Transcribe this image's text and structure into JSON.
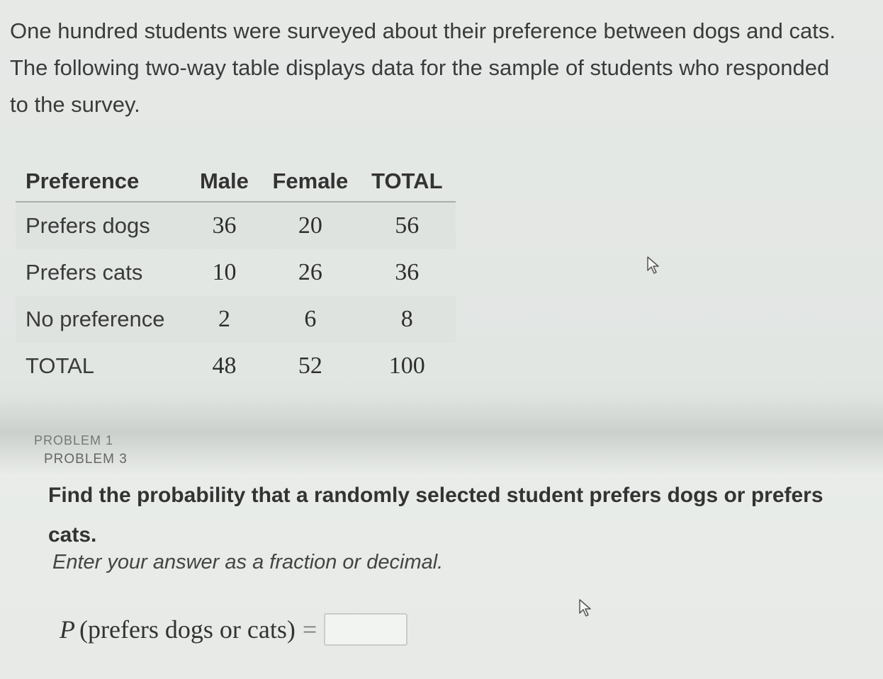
{
  "intro_text": "One hundred students were surveyed about their preference between dogs and cats. The following two-way table displays data for the sample of students who responded to the survey.",
  "table": {
    "headers": [
      "Preference",
      "Male",
      "Female",
      "TOTAL"
    ],
    "rows": [
      {
        "label": "Prefers dogs",
        "male": "36",
        "female": "20",
        "total": "56"
      },
      {
        "label": "Prefers cats",
        "male": "10",
        "female": "26",
        "total": "36"
      },
      {
        "label": "No preference",
        "male": "2",
        "female": "6",
        "total": "8"
      },
      {
        "label": "TOTAL",
        "male": "48",
        "female": "52",
        "total": "100"
      }
    ]
  },
  "breadcrumbs": [
    "PROBLEM 1",
    "PROBLEM 3"
  ],
  "question": "Find the probability that a randomly selected student prefers dogs or prefers cats.",
  "instruction": "Enter your answer as a fraction or decimal.",
  "answer": {
    "p_symbol": "P",
    "expression": "(prefers dogs or cats)",
    "equals": "=",
    "value": ""
  },
  "icons": [
    "mouse-cursor-icon",
    "mouse-cursor-icon"
  ]
}
